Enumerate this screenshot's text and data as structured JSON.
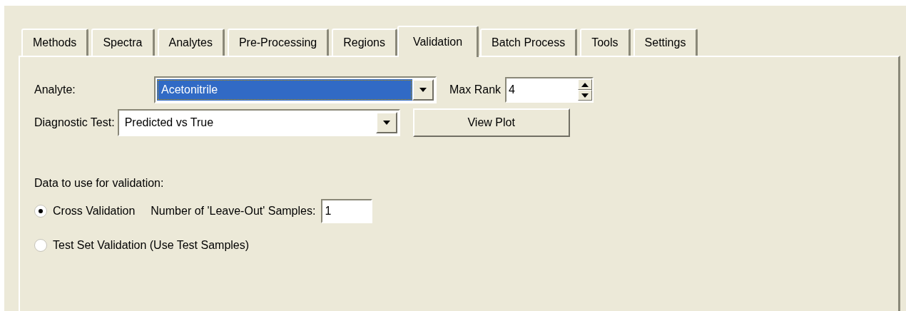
{
  "tabs": [
    {
      "label": "Methods",
      "selected": false
    },
    {
      "label": "Spectra",
      "selected": false
    },
    {
      "label": "Analytes",
      "selected": false
    },
    {
      "label": "Pre-Processing",
      "selected": false
    },
    {
      "label": "Regions",
      "selected": false
    },
    {
      "label": "Validation",
      "selected": true
    },
    {
      "label": "Batch Process",
      "selected": false
    },
    {
      "label": "Tools",
      "selected": false
    },
    {
      "label": "Settings",
      "selected": false
    }
  ],
  "analyte": {
    "label": "Analyte:",
    "value": "Acetonitrile",
    "highlighted": true
  },
  "max_rank": {
    "label": "Max Rank",
    "value": "4"
  },
  "diagnostic_test": {
    "label": "Diagnostic Test:",
    "value": "Predicted vs True",
    "highlighted": false
  },
  "view_plot_button": "View Plot",
  "validation_data": {
    "label": "Data to use for validation:",
    "options": [
      {
        "label": "Cross Validation",
        "selected": true
      },
      {
        "label": "Test Set Validation (Use Test Samples)",
        "selected": false
      }
    ],
    "leave_out": {
      "label": "Number of 'Leave-Out' Samples:",
      "value": "1"
    }
  }
}
